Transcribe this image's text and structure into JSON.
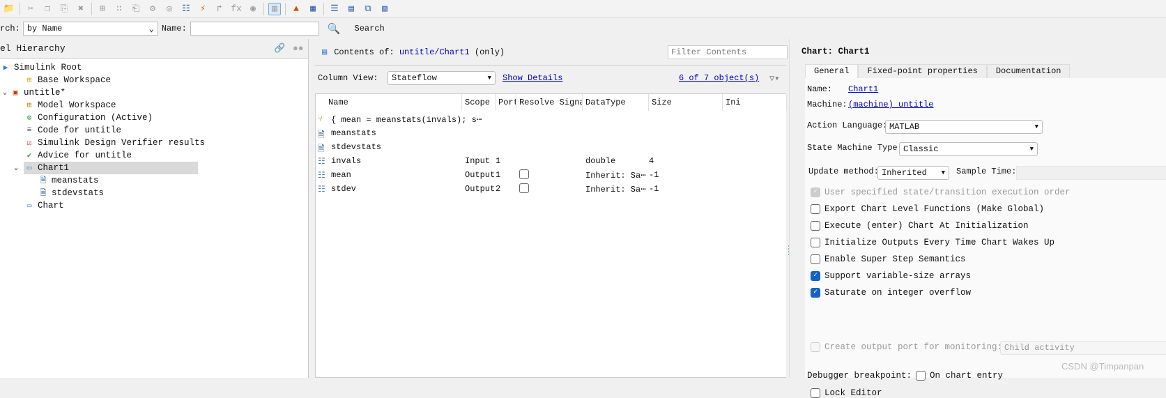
{
  "toolbar": {
    "icons": [
      "open-folder-icon",
      "cut-icon",
      "copy-icon",
      "paste-icon",
      "delete-icon",
      "add-state-icon",
      "add-data-icon",
      "add-event-icon",
      "config-icon",
      "target-icon",
      "data-icon",
      "trigger-icon",
      "function-icon",
      "fx-icon",
      "message-icon",
      "table-view-icon",
      "matlab-icon",
      "model-explorer-icon",
      "filter-view-icon",
      "highlight-icon",
      "refresh-icon",
      "copy-view-icon"
    ]
  },
  "search": {
    "label": "rch:",
    "by_value": "by Name",
    "name_label": "Name:",
    "name_value": "",
    "button": "Search"
  },
  "hierarchy": {
    "title": "el Hierarchy",
    "items": [
      {
        "label": "Simulink Root",
        "icon": "simulink-root-icon"
      },
      {
        "label": "Base Workspace",
        "icon": "workspace-icon"
      },
      {
        "label": "untitle*",
        "icon": "model-icon"
      },
      {
        "label": "Model Workspace",
        "icon": "model-workspace-icon"
      },
      {
        "label": "Configuration (Active)",
        "icon": "configuration-icon"
      },
      {
        "label": "Code for untitle",
        "icon": "code-icon"
      },
      {
        "label": "Simulink Design Verifier results",
        "icon": "verifier-icon"
      },
      {
        "label": "Advice for untitle",
        "icon": "advice-icon"
      },
      {
        "label": "Chart1",
        "icon": "chart-icon"
      },
      {
        "label": "meanstats",
        "icon": "matlab-function-icon"
      },
      {
        "label": "stdevstats",
        "icon": "matlab-function-icon"
      },
      {
        "label": "Chart",
        "icon": "chart-icon"
      }
    ]
  },
  "contents": {
    "prefix": "Contents of:",
    "path": "untitle/Chart1",
    "suffix": "(only)",
    "filter_placeholder": "Filter Contents",
    "column_view_label": "Column View:",
    "column_view": "Stateflow",
    "show_details": "Show Details",
    "count": "6 of 7 object(s)",
    "columns": [
      "Name",
      "Scope",
      "Port",
      "Resolve Signal",
      "DataType",
      "Size",
      "Ini"
    ],
    "rows": [
      {
        "name": "{ mean = meanstats(invals); s⋯",
        "icon": "transition-icon",
        "scope": "",
        "port": "",
        "resolve": null,
        "datatype": "",
        "size": ""
      },
      {
        "name": "meanstats",
        "icon": "matlab-function-icon",
        "scope": "",
        "port": "",
        "resolve": null,
        "datatype": "",
        "size": ""
      },
      {
        "name": "stdevstats",
        "icon": "matlab-function-icon",
        "scope": "",
        "port": "",
        "resolve": null,
        "datatype": "",
        "size": ""
      },
      {
        "name": "invals",
        "icon": "data-icon",
        "scope": "Input",
        "port": "1",
        "resolve": null,
        "datatype": "double",
        "size": "4"
      },
      {
        "name": "mean",
        "icon": "data-icon",
        "scope": "Output",
        "port": "1",
        "resolve": false,
        "datatype": "Inherit: Sa⋯",
        "size": "-1"
      },
      {
        "name": "stdev",
        "icon": "data-icon",
        "scope": "Output",
        "port": "2",
        "resolve": false,
        "datatype": "Inherit: Sa⋯",
        "size": "-1"
      }
    ]
  },
  "props": {
    "title": "Chart: Chart1",
    "tabs": [
      "General",
      "Fixed-point properties",
      "Documentation"
    ],
    "name_label": "Name:",
    "name": "Chart1",
    "machine_label": "Machine:",
    "machine": "(machine) untitle",
    "action_language_label": "Action Language:",
    "action_language": "MATLAB",
    "smt_label": "State Machine Type:",
    "smt": "Classic",
    "update_label": "Update method:",
    "update": "Inherited",
    "sample_label": "Sample Time:",
    "sample": "",
    "checks": [
      {
        "label": "User specified state/transition execution order",
        "checked": true,
        "disabled": true
      },
      {
        "label": "Export Chart Level Functions (Make Global)",
        "checked": false
      },
      {
        "label": "Execute (enter) Chart At Initialization",
        "checked": false
      },
      {
        "label": "Initialize Outputs Every Time Chart Wakes Up",
        "checked": false
      },
      {
        "label": "Enable Super Step Semantics",
        "checked": false
      },
      {
        "label": "Support variable-size arrays",
        "checked": true
      },
      {
        "label": "Saturate on integer overflow",
        "checked": true
      }
    ],
    "monitor_label": "Create output port for monitoring:",
    "monitor_value": "Child activity",
    "debugger_label": "Debugger breakpoint:",
    "debugger_option": "On chart entry",
    "lock_label": "Lock Editor"
  },
  "watermark": "CSDN @Timpanpan",
  "colors": {
    "link": "#0000c0",
    "checked": "#1463c4",
    "selection": "#d9d9d9"
  }
}
